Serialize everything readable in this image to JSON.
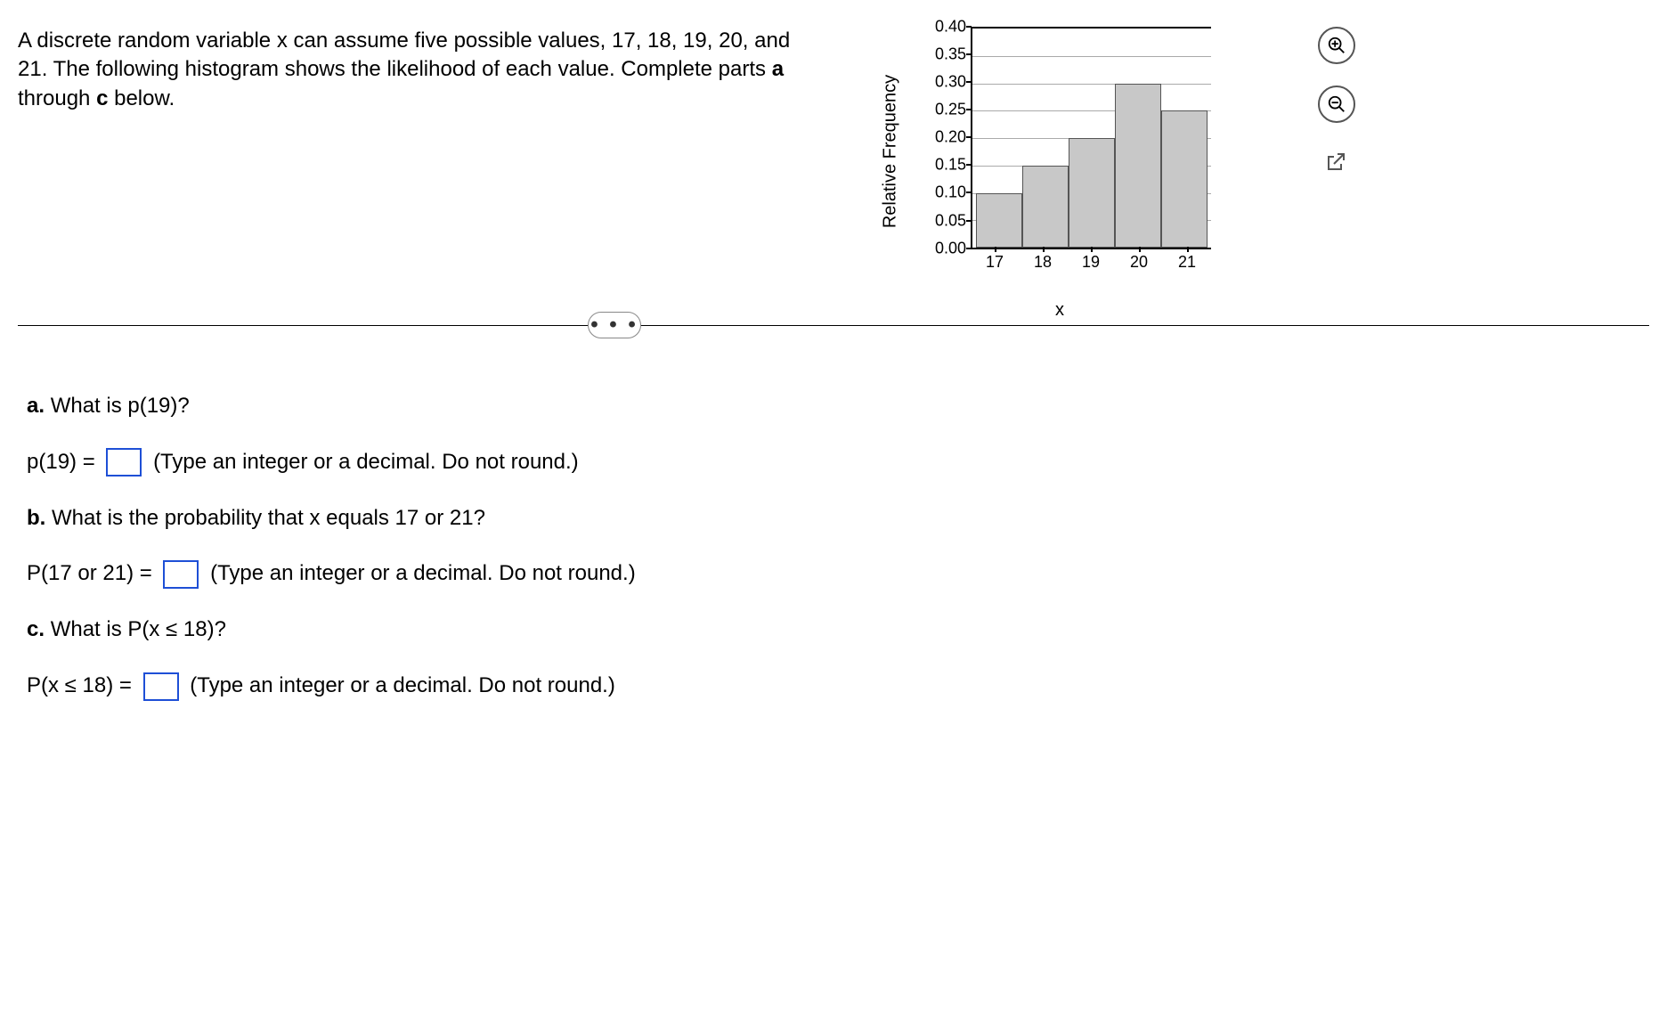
{
  "prompt": "A discrete random variable x can assume five possible values, 17, 18, 19, 20, and 21. The following histogram shows the likelihood of each value. Complete parts a through c below.",
  "divider_dots": "• • •",
  "questions": {
    "a": {
      "label": "a.",
      "text": "What is p(19)?",
      "answer_prefix": "p(19) =",
      "hint": "(Type an integer or a decimal. Do not round.)"
    },
    "b": {
      "label": "b.",
      "text": "What is the probability that x equals 17 or 21?",
      "answer_prefix": "P(17 or 21) =",
      "hint": "(Type an integer or a decimal. Do not round.)"
    },
    "c": {
      "label": "c.",
      "text": "What is P(x ≤ 18)?",
      "answer_prefix": "P(x ≤ 18) =",
      "hint": "(Type an integer or a decimal. Do not round.)"
    }
  },
  "chart_data": {
    "type": "bar",
    "categories": [
      "17",
      "18",
      "19",
      "20",
      "21"
    ],
    "values": [
      0.1,
      0.15,
      0.2,
      0.3,
      0.25
    ],
    "xlabel": "x",
    "ylabel": "Relative Frequency",
    "ylim": [
      0.0,
      0.4
    ],
    "yticks": [
      "0.40",
      "0.35",
      "0.30",
      "0.25",
      "0.20",
      "0.15",
      "0.10",
      "0.05",
      "0.00"
    ]
  }
}
